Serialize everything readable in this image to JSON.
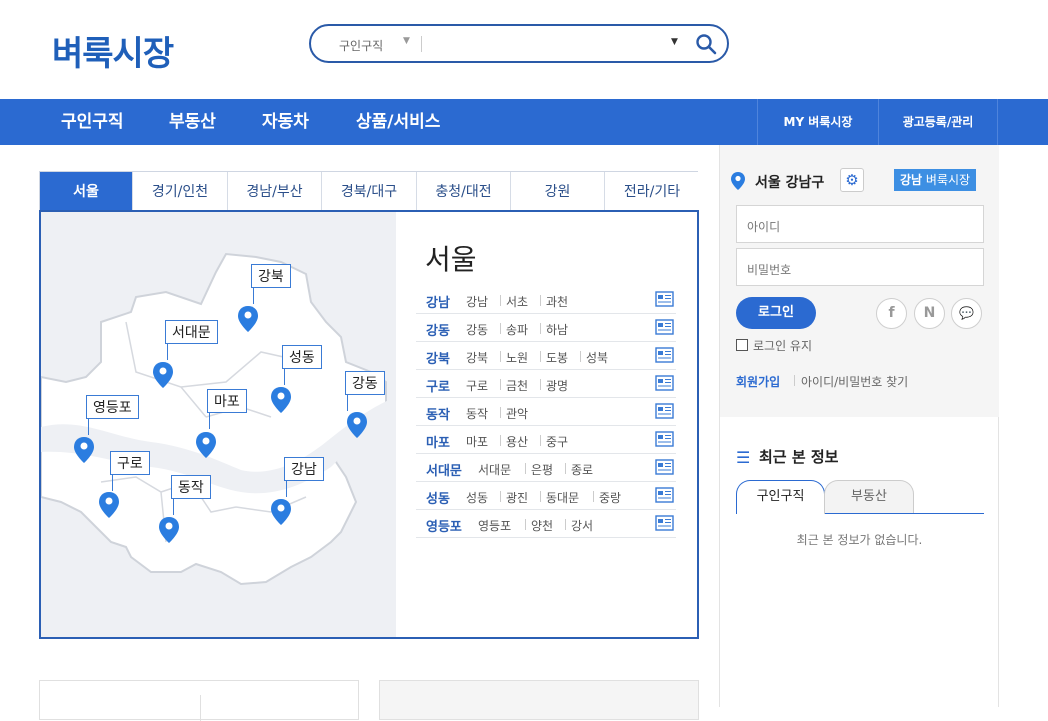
{
  "header": {
    "logo": "벼룩시장",
    "search": {
      "category": "구인구직",
      "value": ""
    }
  },
  "nav": {
    "items": [
      "구인구직",
      "부동산",
      "자동차",
      "상품/서비스"
    ],
    "right": [
      "MY 벼룩시장",
      "광고등록/관리"
    ]
  },
  "regions": {
    "tabs": [
      "서울",
      "경기/인천",
      "경남/부산",
      "경북/대구",
      "충청/대전",
      "강원",
      "전라/기타"
    ],
    "active": "서울"
  },
  "map": {
    "labels": [
      "강북",
      "서대문",
      "성동",
      "강동",
      "영등포",
      "마포",
      "구로",
      "동작",
      "강남"
    ]
  },
  "city": {
    "title": "서울",
    "rows": [
      {
        "key": "강남",
        "districts": [
          "강남",
          "서초",
          "과천"
        ]
      },
      {
        "key": "강동",
        "districts": [
          "강동",
          "송파",
          "하남"
        ]
      },
      {
        "key": "강북",
        "districts": [
          "강북",
          "노원",
          "도봉",
          "성북"
        ]
      },
      {
        "key": "구로",
        "districts": [
          "구로",
          "금천",
          "광명"
        ]
      },
      {
        "key": "동작",
        "districts": [
          "동작",
          "관악"
        ]
      },
      {
        "key": "마포",
        "districts": [
          "마포",
          "용산",
          "중구"
        ]
      },
      {
        "key": "서대문",
        "districts": [
          "서대문",
          "은평",
          "종로"
        ]
      },
      {
        "key": "성동",
        "districts": [
          "성동",
          "광진",
          "동대문",
          "중랑"
        ]
      },
      {
        "key": "영등포",
        "districts": [
          "영등포",
          "양천",
          "강서"
        ]
      }
    ]
  },
  "sidebar": {
    "location": "서울 강남구",
    "badge_region": "강남",
    "badge_label": "벼룩시장",
    "id_placeholder": "아이디",
    "pw_placeholder": "비밀번호",
    "login_button": "로그인",
    "keep_login": "로그인 유지",
    "signup": "회원가입",
    "find": "아이디/비밀번호 찾기",
    "social": [
      "f",
      "N",
      "💬"
    ],
    "recent_title": "최근 본 정보",
    "recent_tabs": [
      "구인구직",
      "부동산"
    ],
    "recent_empty": "최근 본 정보가 없습니다."
  },
  "colors": {
    "primary": "#2b6ad1",
    "logo": "#1f5fb9"
  }
}
